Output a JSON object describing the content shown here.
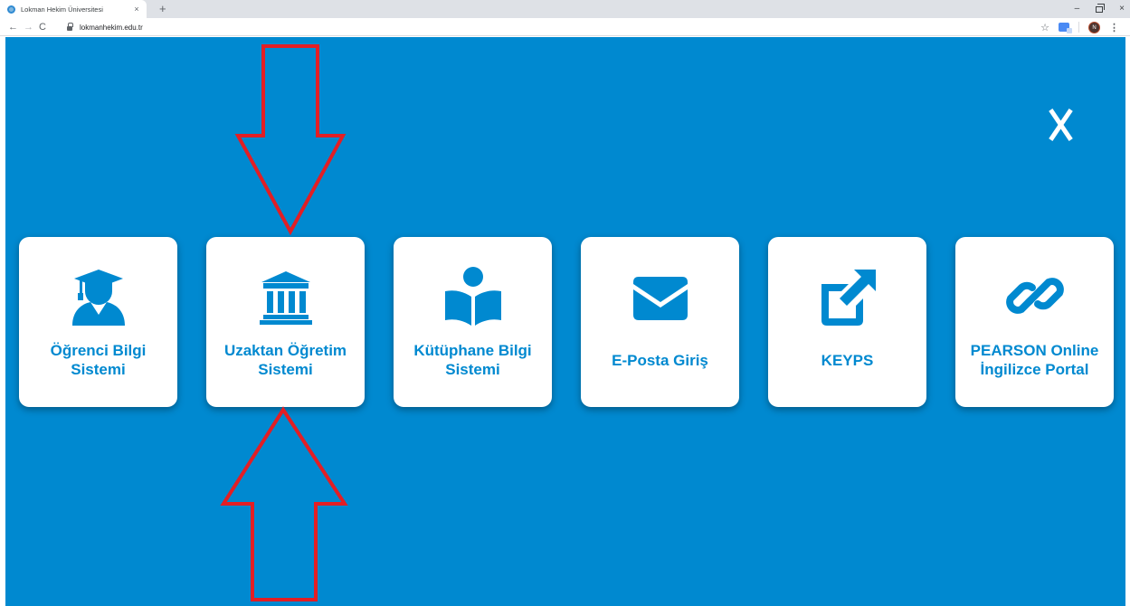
{
  "browser": {
    "tab_title": "Lokman Hekim Üniversitesi",
    "tab_close": "×",
    "new_tab": "+",
    "url": "lokmanhekim.edu.tr",
    "back": "←",
    "forward": "→",
    "reload": "C",
    "star": "☆",
    "menu": "⋮",
    "profile_initial": "N",
    "minimize": "–",
    "close": "×"
  },
  "page": {
    "background_color": "#0089d0",
    "accent_color": "#0089d0",
    "annotation_color": "#e31e24",
    "cards": [
      {
        "icon": "graduation-cap-student-icon",
        "line1": "Öğrenci Bilgi",
        "line2": "Sistemi"
      },
      {
        "icon": "institution-building-icon",
        "line1": "Uzaktan Öğretim",
        "line2": "Sistemi"
      },
      {
        "icon": "reader-book-icon",
        "line1": "Kütüphane Bilgi",
        "line2": "Sistemi"
      },
      {
        "icon": "envelope-icon",
        "line1": "E-Posta Giriş",
        "line2": ""
      },
      {
        "icon": "external-link-icon",
        "line1": "KEYPS",
        "line2": ""
      },
      {
        "icon": "chain-link-icon",
        "line1": "PEARSON Online",
        "line2": "İngilizce Portal"
      }
    ]
  }
}
